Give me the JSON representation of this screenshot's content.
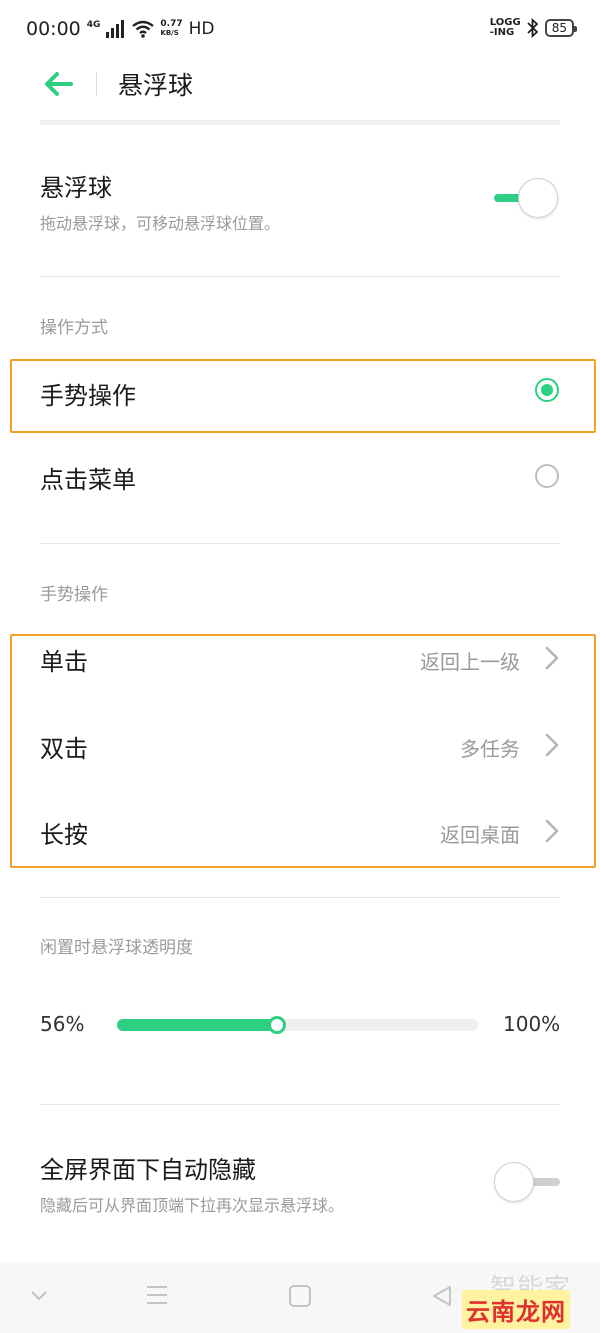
{
  "status_bar": {
    "time": "00:00",
    "network": "4G",
    "speed_value": "0.77",
    "speed_unit": "KB/S",
    "hd": "HD",
    "logging_top": "LOGG",
    "logging_bottom": "-ING",
    "battery": "85"
  },
  "header": {
    "title": "悬浮球",
    "back_icon": "arrow-left-icon"
  },
  "floating_ball": {
    "title": "悬浮球",
    "subtitle": "拖动悬浮球，可移动悬浮球位置。",
    "enabled": true
  },
  "operation_mode": {
    "label": "操作方式",
    "options": [
      {
        "label": "手势操作",
        "selected": true
      },
      {
        "label": "点击菜单",
        "selected": false
      }
    ]
  },
  "gestures": {
    "label": "手势操作",
    "items": [
      {
        "label": "单击",
        "value": "返回上一级"
      },
      {
        "label": "双击",
        "value": "多任务"
      },
      {
        "label": "长按",
        "value": "返回桌面"
      }
    ]
  },
  "idle_opacity": {
    "label": "闲置时悬浮球透明度",
    "min_label": "56%",
    "max_label": "100%",
    "fill_fraction": 0.46
  },
  "auto_hide": {
    "title": "全屏界面下自动隐藏",
    "subtitle": "隐藏后可从界面顶端下拉再次显示悬浮球。",
    "enabled": false
  },
  "nav_bar": {
    "icons": [
      "chevron-down-icon",
      "menu-icon",
      "home-square-icon",
      "back-triangle-icon"
    ]
  },
  "watermark": {
    "top": "智能家",
    "bottom": "云南龙网"
  },
  "colors": {
    "accent": "#2dcf82",
    "highlight": "#f0a02a"
  }
}
